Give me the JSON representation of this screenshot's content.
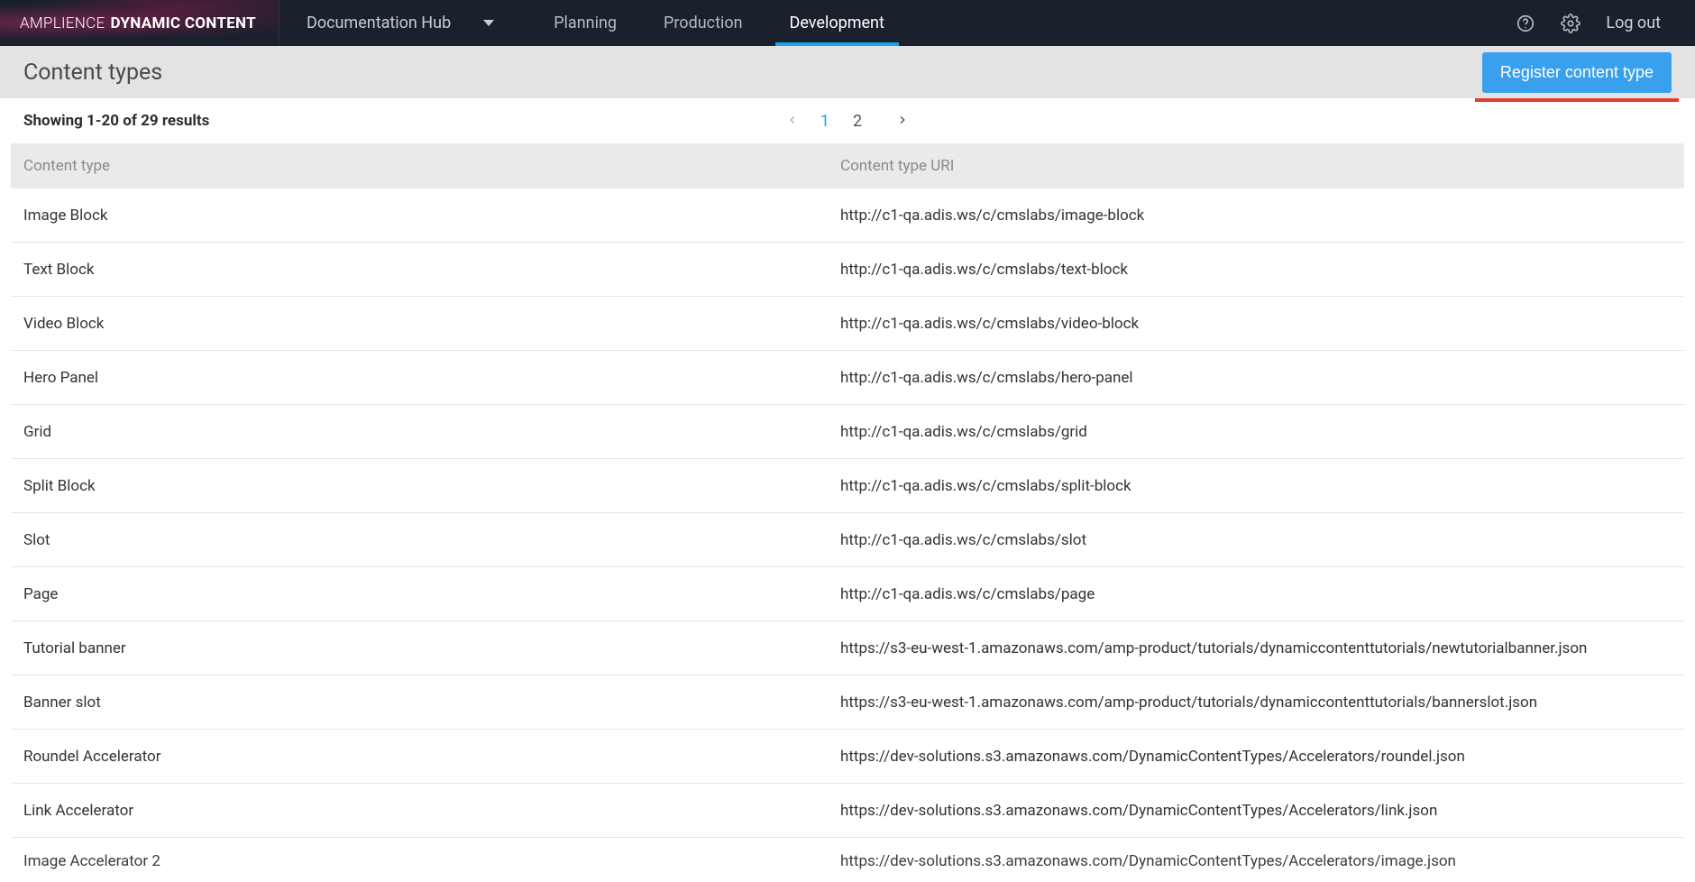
{
  "brand": {
    "light": "AMPLIENCE",
    "bold": "DYNAMIC CONTENT"
  },
  "hub_selector": {
    "label": "Documentation Hub"
  },
  "nav": {
    "tabs": [
      {
        "label": "Planning",
        "active": false
      },
      {
        "label": "Production",
        "active": false
      },
      {
        "label": "Development",
        "active": true
      }
    ]
  },
  "topbar_right": {
    "logout": "Log out"
  },
  "page": {
    "title": "Content types",
    "register_button": "Register content type"
  },
  "results": {
    "summary": "Showing 1-20 of 29 results",
    "pages": [
      "1",
      "2"
    ],
    "current_page": "1"
  },
  "table": {
    "headers": {
      "name": "Content type",
      "uri": "Content type URI"
    },
    "rows": [
      {
        "name": "Image Block",
        "uri": "http://c1-qa.adis.ws/c/cmslabs/image-block"
      },
      {
        "name": "Text Block",
        "uri": "http://c1-qa.adis.ws/c/cmslabs/text-block"
      },
      {
        "name": "Video Block",
        "uri": "http://c1-qa.adis.ws/c/cmslabs/video-block"
      },
      {
        "name": "Hero Panel",
        "uri": "http://c1-qa.adis.ws/c/cmslabs/hero-panel"
      },
      {
        "name": "Grid",
        "uri": "http://c1-qa.adis.ws/c/cmslabs/grid"
      },
      {
        "name": "Split Block",
        "uri": "http://c1-qa.adis.ws/c/cmslabs/split-block"
      },
      {
        "name": "Slot",
        "uri": "http://c1-qa.adis.ws/c/cmslabs/slot"
      },
      {
        "name": "Page",
        "uri": "http://c1-qa.adis.ws/c/cmslabs/page"
      },
      {
        "name": "Tutorial banner",
        "uri": "https://s3-eu-west-1.amazonaws.com/amp-product/tutorials/dynamiccontenttutorials/newtutorialbanner.json"
      },
      {
        "name": "Banner slot",
        "uri": "https://s3-eu-west-1.amazonaws.com/amp-product/tutorials/dynamiccontenttutorials/bannerslot.json"
      },
      {
        "name": "Roundel Accelerator",
        "uri": "https://dev-solutions.s3.amazonaws.com/DynamicContentTypes/Accelerators/roundel.json"
      },
      {
        "name": "Link Accelerator",
        "uri": "https://dev-solutions.s3.amazonaws.com/DynamicContentTypes/Accelerators/link.json"
      }
    ],
    "partial_row": {
      "name": "Image Accelerator 2",
      "uri": "https://dev-solutions.s3.amazonaws.com/DynamicContentTypes/Accelerators/image.json"
    }
  }
}
